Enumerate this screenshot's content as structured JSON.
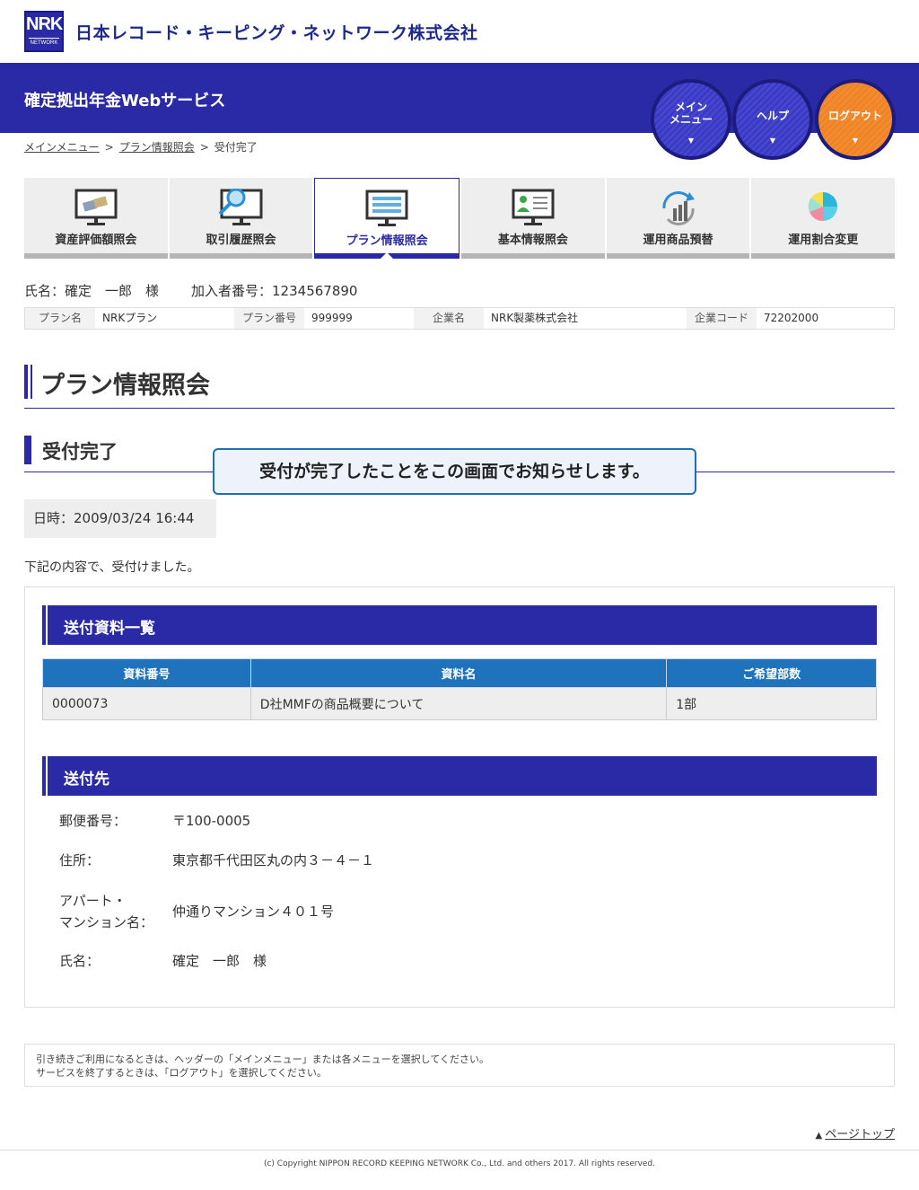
{
  "header": {
    "logo_text": "NRK",
    "logo_sub": "NETWORK",
    "company": "日本レコード・キーピング・ネットワーク株式会社",
    "service_title": "確定拠出年金Webサービス",
    "buttons": {
      "main_menu": "メイン\nメニュー",
      "help": "ヘルプ",
      "logout": "ログアウト"
    },
    "colors": {
      "brand": "#2a2aa6",
      "logout": "#f08424"
    }
  },
  "breadcrumb": {
    "items": [
      "メインメニュー",
      "プラン情報照会",
      "受付完了"
    ],
    "separator": ">"
  },
  "tabs": [
    {
      "label": "資産評価額照会",
      "icon": "monitor-money-icon"
    },
    {
      "label": "取引履歴照会",
      "icon": "monitor-magnifier-icon"
    },
    {
      "label": "プラン情報照会",
      "icon": "monitor-list-icon",
      "active": true
    },
    {
      "label": "基本情報照会",
      "icon": "monitor-person-icon"
    },
    {
      "label": "運用商品預替",
      "icon": "refresh-chart-icon"
    },
    {
      "label": "運用割合変更",
      "icon": "pie-chart-icon"
    }
  ],
  "user": {
    "name_label": "氏名：確定　一郎　様",
    "member_no_label": "加入者番号：1234567890"
  },
  "plan_info": {
    "plan_name_key": "プラン名",
    "plan_name": "NRKプラン",
    "plan_no_key": "プラン番号",
    "plan_no": "999999",
    "company_key": "企業名",
    "company": "NRK製薬株式会社",
    "company_code_key": "企業コード",
    "company_code": "72202000"
  },
  "page": {
    "title": "プラン情報照会",
    "subtitle": "受付完了",
    "callout": "受付が完了したことをこの画面でお知らせします。",
    "datetime": "日時：2009/03/24 16:44",
    "notice": "下記の内容で、受付けました。"
  },
  "documents": {
    "section_title": "送付資料一覧",
    "columns": [
      "資料番号",
      "資料名",
      "ご希望部数"
    ],
    "rows": [
      [
        "0000073",
        "D社MMFの商品概要について",
        "1部"
      ]
    ]
  },
  "destination": {
    "section_title": "送付先",
    "postal_key": "郵便番号：",
    "postal": "〒100-0005",
    "address_key": "住所：",
    "address": "東京都千代田区丸の内３－４－１",
    "building_key_1": "アパート・",
    "building_key_2": "マンション名：",
    "building": "仲通りマンション４０１号",
    "name_key": "氏名：",
    "name": "確定　一郎　様"
  },
  "footer": {
    "note_1": "引き続きご利用になるときは、ヘッダーの「メインメニュー」または各メニューを選択してください。",
    "note_2": "サービスを終了するときは、「ログアウト」を選択してください。",
    "pagetop": "ページトップ",
    "copyright": "(c) Copyright NIPPON RECORD KEEPING NETWORK Co., Ltd. and others 2017. All rights reserved."
  }
}
